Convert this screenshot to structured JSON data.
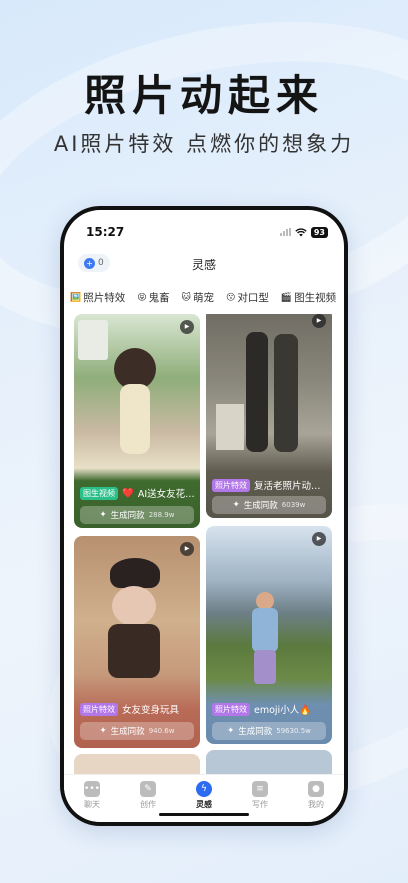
{
  "hero": {
    "title": "照片动起来",
    "subtitle": "AI照片特效 点燃你的想象力"
  },
  "status_bar": {
    "time": "15:27",
    "battery": "93"
  },
  "header": {
    "coin_count": "0",
    "title": "灵感"
  },
  "category_tabs": [
    {
      "icon": "🖼️",
      "label": "照片特效"
    },
    {
      "icon": "😝",
      "label": "鬼畜"
    },
    {
      "icon": "🐱",
      "label": "萌宠"
    },
    {
      "icon": "😗",
      "label": "对口型"
    },
    {
      "icon": "🎬",
      "label": "图生视频"
    }
  ],
  "cards": [
    {
      "tag": "图生视频",
      "tag_color": "#2bbf8a",
      "emoji": "❤️",
      "title": "AI送女友花…",
      "button": "生成同款",
      "count": "288.9w",
      "panel_color": "#3f6b2f"
    },
    {
      "tag": "照片特效",
      "tag_color": "#b277e8",
      "emoji": "",
      "title": "复活老照片动…",
      "button": "生成同款",
      "count": "6039w",
      "panel_color": "#5f5c4f"
    },
    {
      "tag": "照片特效",
      "tag_color": "#b277e8",
      "emoji": "",
      "title": "女友变身玩具",
      "button": "生成同款",
      "count": "940.6w",
      "panel_color": "#b86b57"
    },
    {
      "tag": "照片特效",
      "tag_color": "#b277e8",
      "emoji": "",
      "title": "emoji小人🔥",
      "button": "生成同款",
      "count": "59630.5w",
      "panel_color": "#6f8fb0"
    }
  ],
  "tabbar": [
    {
      "icon": "chat",
      "label": "聊天",
      "active": false
    },
    {
      "icon": "create",
      "label": "创作",
      "active": false
    },
    {
      "icon": "bolt",
      "label": "灵感",
      "active": true
    },
    {
      "icon": "write",
      "label": "写作",
      "active": false
    },
    {
      "icon": "user",
      "label": "我的",
      "active": false
    }
  ]
}
